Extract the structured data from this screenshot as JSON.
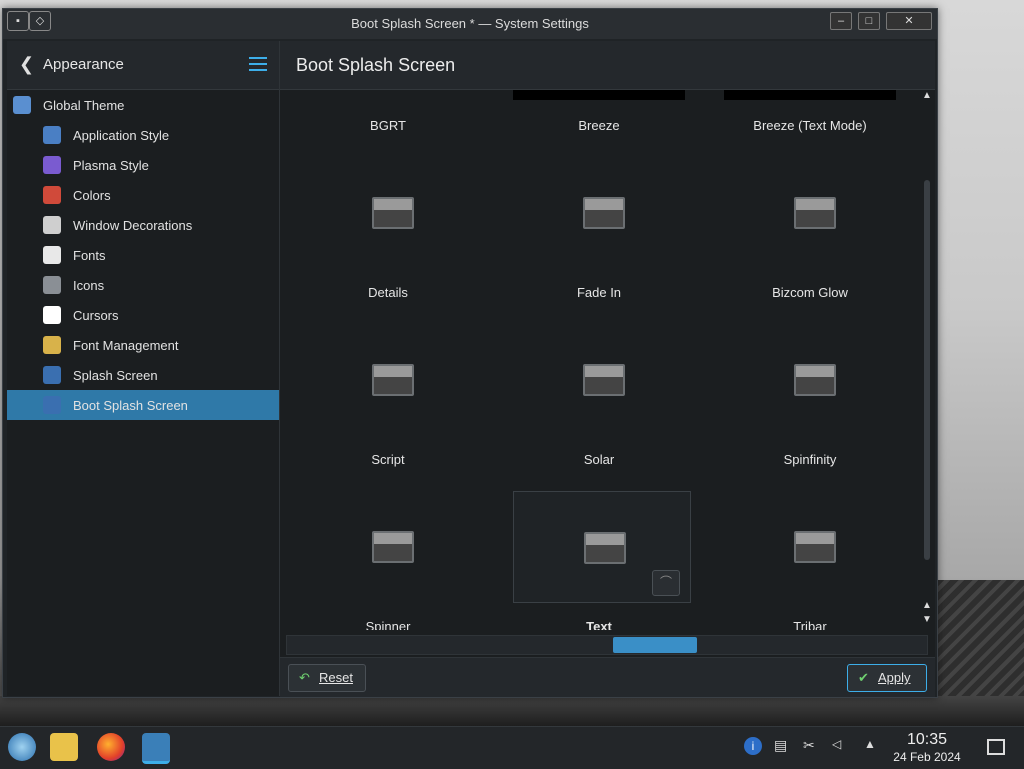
{
  "window": {
    "title": "Boot Splash Screen * — System Settings",
    "left_buttons": [
      "window-menu",
      "keep-above"
    ],
    "right_buttons": [
      "minimize",
      "maximize",
      "close"
    ]
  },
  "sidebar": {
    "header": {
      "back_label": "Appearance"
    },
    "items": [
      {
        "label": "Global Theme",
        "icon": "global-theme-icon",
        "level": "top",
        "color": "#5a8fd0"
      },
      {
        "label": "Application Style",
        "icon": "application-style-icon",
        "level": "sub",
        "color": "#4a7fc4"
      },
      {
        "label": "Plasma Style",
        "icon": "plasma-style-icon",
        "level": "sub",
        "color": "#7a5bd0"
      },
      {
        "label": "Colors",
        "icon": "colors-icon",
        "level": "sub",
        "color": "#d04a3a"
      },
      {
        "label": "Window Decorations",
        "icon": "window-decorations-icon",
        "level": "sub",
        "color": "#cfcfcf"
      },
      {
        "label": "Fonts",
        "icon": "fonts-icon",
        "level": "sub",
        "color": "#e8e8e8"
      },
      {
        "label": "Icons",
        "icon": "icons-icon",
        "level": "sub",
        "color": "#8a8f95"
      },
      {
        "label": "Cursors",
        "icon": "cursors-icon",
        "level": "sub",
        "color": "#ffffff"
      },
      {
        "label": "Font Management",
        "icon": "font-management-icon",
        "level": "sub",
        "color": "#d8b24a"
      },
      {
        "label": "Splash Screen",
        "icon": "splash-screen-icon",
        "level": "sub",
        "color": "#3a6fb0"
      },
      {
        "label": "Boot Splash Screen",
        "icon": "boot-splash-screen-icon",
        "level": "sub",
        "color": "#3a6fb0",
        "active": true
      }
    ]
  },
  "main": {
    "title": "Boot Splash Screen",
    "themes": [
      {
        "label": "BGRT"
      },
      {
        "label": "Breeze"
      },
      {
        "label": "Breeze (Text Mode)"
      },
      {
        "label": "Details"
      },
      {
        "label": "Fade In"
      },
      {
        "label": "Bizcom Glow"
      },
      {
        "label": "Script"
      },
      {
        "label": "Solar"
      },
      {
        "label": "Spinfinity"
      },
      {
        "label": "Spinner"
      },
      {
        "label": "Text",
        "selected": true
      },
      {
        "label": "Tribar"
      }
    ]
  },
  "footer": {
    "reset_label": "Reset",
    "apply_label": "Apply"
  },
  "taskbar": {
    "launchers": [
      "application-launcher-icon",
      "file-manager-icon",
      "firefox-icon",
      "system-settings-icon"
    ],
    "tray": [
      "info-icon",
      "clipboard-icon",
      "scissors-icon",
      "volume-icon",
      "expand-tray-icon"
    ],
    "time": "10:35",
    "date": "24 Feb 2024"
  },
  "colors": {
    "accent": "#3daee9",
    "selection": "#2f79a8",
    "window_bg": "#1b1e20"
  }
}
